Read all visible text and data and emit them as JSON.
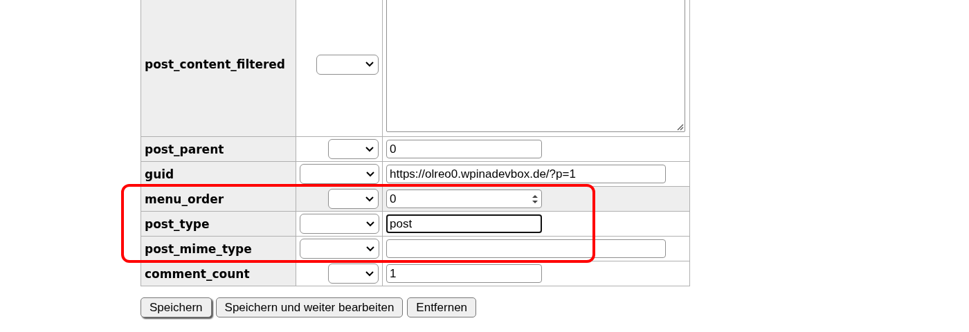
{
  "rows": [
    {
      "label": "post_content_filtered",
      "kind": "textarea",
      "value": "",
      "highlighted": false,
      "focused": false,
      "outlined": false
    },
    {
      "label": "post_parent",
      "kind": "text",
      "value": "0",
      "highlighted": false,
      "focused": false,
      "outlined": false
    },
    {
      "label": "guid",
      "kind": "text",
      "value": "https://olreo0.wpinadevbox.de/?p=1",
      "highlighted": false,
      "focused": false,
      "outlined": false
    },
    {
      "label": "menu_order",
      "kind": "number",
      "value": "0",
      "highlighted": true,
      "focused": false,
      "outlined": true
    },
    {
      "label": "post_type",
      "kind": "text",
      "value": "post",
      "highlighted": false,
      "focused": true,
      "outlined": true
    },
    {
      "label": "post_mime_type",
      "kind": "text",
      "value": "",
      "highlighted": false,
      "focused": false,
      "outlined": true
    },
    {
      "label": "comment_count",
      "kind": "text",
      "value": "1",
      "highlighted": false,
      "focused": false,
      "outlined": false
    }
  ],
  "buttons": [
    {
      "label": "Speichern",
      "default": true
    },
    {
      "label": "Speichern und weiter bearbeiten",
      "default": false
    },
    {
      "label": "Entfernen",
      "default": false
    }
  ]
}
